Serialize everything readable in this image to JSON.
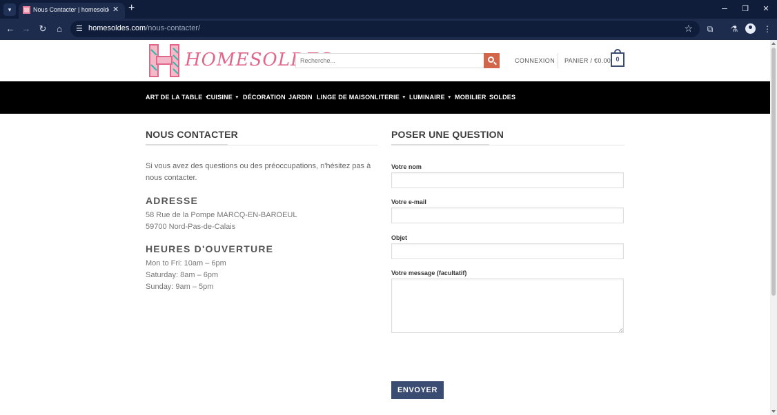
{
  "browser": {
    "tab_title": "Nous Contacter | homesoldes.c...",
    "url_domain": "homesoldes.com",
    "url_path": "/nous-contacter/"
  },
  "header": {
    "logo_text": "HOMESOLDES",
    "search_placeholder": "Recherche...",
    "connexion": "CONNEXION",
    "cart_label": "PANIER / €0.00",
    "cart_count": "0"
  },
  "nav": {
    "items": [
      {
        "label": "ART DE LA TABLE",
        "has_dropdown": true
      },
      {
        "label": "CUISINE",
        "has_dropdown": true
      },
      {
        "label": "DÉCORATION",
        "has_dropdown": false
      },
      {
        "label": "JARDIN",
        "has_dropdown": false
      },
      {
        "label": "LINGE DE MAISON",
        "has_dropdown": false
      },
      {
        "label": "LITERIE",
        "has_dropdown": true
      },
      {
        "label": "LUMINAIRE",
        "has_dropdown": true
      },
      {
        "label": "MOBILIER",
        "has_dropdown": false
      },
      {
        "label": "SOLDES",
        "has_dropdown": false
      }
    ]
  },
  "contact": {
    "title": "NOUS CONTACTER",
    "intro": "Si vous avez des questions ou des préoccupations, n'hésitez pas à nous contacter.",
    "address_heading": "ADRESSE",
    "address_line1": "58 Rue de la Pompe MARCQ-EN-BAROEUL",
    "address_line2": "59700 Nord-Pas-de-Calais",
    "hours_heading": "HEURES D'OUVERTURE",
    "hours": [
      "Mon to Fri: 10am – 6pm",
      "Saturday: 8am – 6pm",
      "Sunday: 9am – 5pm"
    ]
  },
  "form": {
    "title": "POSER UNE QUESTION",
    "name_label": "Votre nom",
    "email_label": "Votre e-mail",
    "subject_label": "Objet",
    "message_label": "Votre message (facultatif)",
    "submit_label": "ENVOYER"
  },
  "colors": {
    "nav_bg": "#000000",
    "accent": "#3b4c73",
    "search_button": "#d2664a",
    "logo_pink": "#e0668a",
    "logo_teal": "#2fb8a8"
  }
}
